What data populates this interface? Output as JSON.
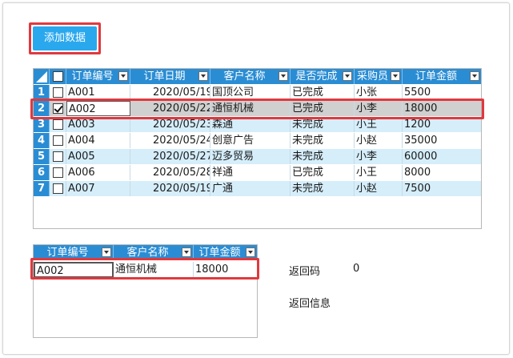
{
  "toolbar": {
    "add_label": "添加数据"
  },
  "orders_table": {
    "columns": [
      "订单编号",
      "订单日期",
      "客户名称",
      "是否完成",
      "采购员",
      "订单金额"
    ],
    "rows": [
      {
        "num": "1",
        "checked": false,
        "id": "A001",
        "date": "2020/05/19",
        "customer": "国顶公司",
        "done": "已完成",
        "buyer": "小张",
        "amount": "5500"
      },
      {
        "num": "2",
        "checked": true,
        "id": "A002",
        "date": "2020/05/22",
        "customer": "通恒机械",
        "done": "已完成",
        "buyer": "小李",
        "amount": "18000"
      },
      {
        "num": "3",
        "checked": false,
        "id": "A003",
        "date": "2020/05/23",
        "customer": "森通",
        "done": "未完成",
        "buyer": "小王",
        "amount": "1200"
      },
      {
        "num": "4",
        "checked": false,
        "id": "A004",
        "date": "2020/05/24",
        "customer": "创意广告",
        "done": "未完成",
        "buyer": "小赵",
        "amount": "35000"
      },
      {
        "num": "5",
        "checked": false,
        "id": "A005",
        "date": "2020/05/27",
        "customer": "迈多贸易",
        "done": "未完成",
        "buyer": "小李",
        "amount": "60000"
      },
      {
        "num": "6",
        "checked": false,
        "id": "A006",
        "date": "2020/05/28",
        "customer": "祥通",
        "done": "已完成",
        "buyer": "小王",
        "amount": "8000"
      },
      {
        "num": "7",
        "checked": false,
        "id": "A007",
        "date": "2020/05/19",
        "customer": "广通",
        "done": "未完成",
        "buyer": "小赵",
        "amount": "7500"
      }
    ]
  },
  "result_table": {
    "columns": [
      "订单编号",
      "客户名称",
      "订单金额"
    ],
    "rows": [
      {
        "id": "A002",
        "customer": "通恒机械",
        "amount": "18000"
      }
    ]
  },
  "return_info": {
    "code_label": "返回码",
    "code_value": "0",
    "message_label": "返回信息",
    "message_value": ""
  },
  "colors": {
    "header": "#2a8dd4",
    "button": "#2aa8ee",
    "highlight_box": "#e0393e",
    "alt_row": "#d5eefa",
    "selected_row": "#d0d0d0"
  }
}
